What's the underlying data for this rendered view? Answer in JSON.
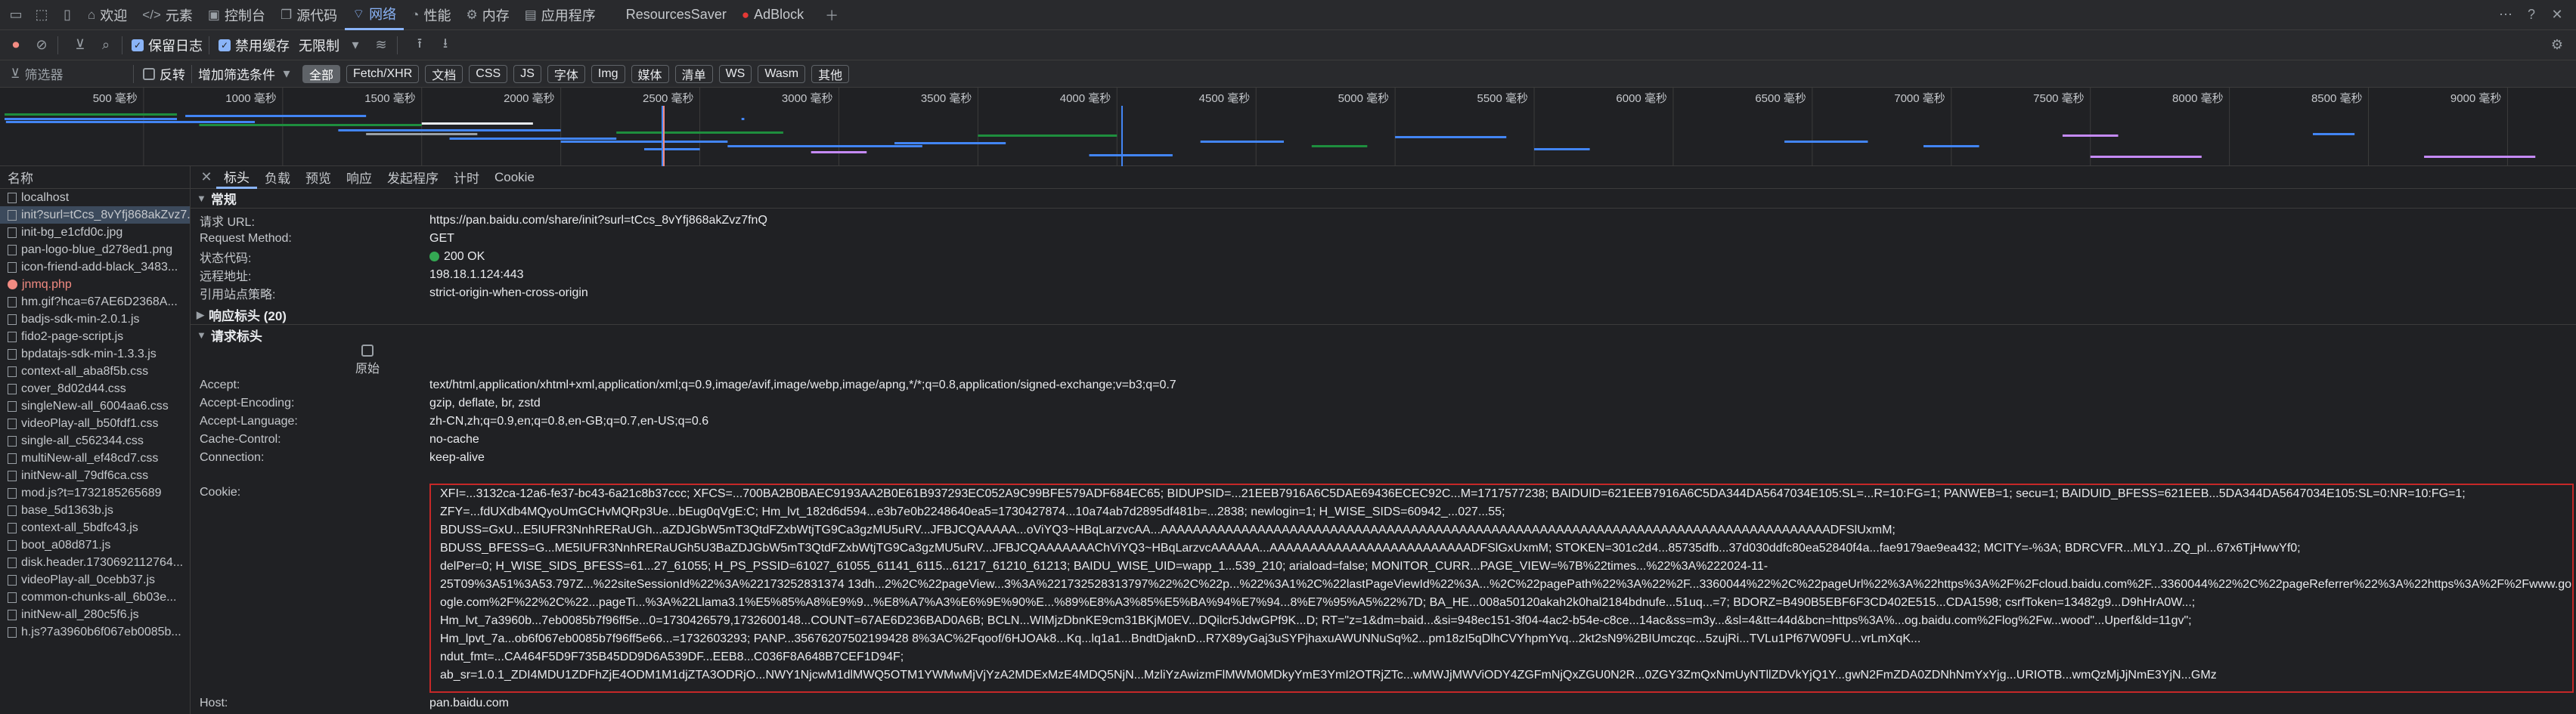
{
  "tabs": [
    {
      "label": "欢迎",
      "icon": "home-icon"
    },
    {
      "label": "元素",
      "icon": "code-icon"
    },
    {
      "label": "控制台",
      "icon": "console-icon"
    },
    {
      "label": "源代码",
      "icon": "source-icon"
    },
    {
      "label": "网络",
      "icon": "wifi-icon",
      "active": true
    },
    {
      "label": "性能",
      "icon": "performance-icon"
    },
    {
      "label": "内存",
      "icon": "memory-icon"
    },
    {
      "label": "应用程序",
      "icon": "application-icon"
    },
    {
      "label": "ResourcesSaver",
      "icon": ""
    },
    {
      "label": "AdBlock",
      "icon": "adblock-icon"
    }
  ],
  "toolbar": {
    "preserve_log": "保留日志",
    "disable_cache": "禁用缓存",
    "throttle": "无限制"
  },
  "filter": {
    "placeholder": "筛选器",
    "invert": "反转",
    "more": "增加筛选条件",
    "chips": [
      "全部",
      "Fetch/XHR",
      "文档",
      "CSS",
      "JS",
      "字体",
      "Img",
      "媒体",
      "清单",
      "WS",
      "Wasm",
      "其他"
    ]
  },
  "timeline": {
    "ticks": [
      "500 毫秒",
      "1000 毫秒",
      "1500 毫秒",
      "2000 毫秒",
      "2500 毫秒",
      "3000 毫秒",
      "3500 毫秒",
      "4000 毫秒",
      "4500 毫秒",
      "5000 毫秒",
      "5500 毫秒",
      "6000 毫秒",
      "6500 毫秒",
      "7000 毫秒",
      "7500 毫秒",
      "8000 毫秒",
      "8500 毫秒",
      "9000 毫秒"
    ]
  },
  "requests": {
    "header": "名称",
    "items": [
      {
        "name": "localhost",
        "red": false
      },
      {
        "name": "init?surl=tCcs_8vYfj868akZvz7...",
        "red": false,
        "selected": true
      },
      {
        "name": "init-bg_e1cfd0c.jpg",
        "red": false
      },
      {
        "name": "pan-logo-blue_d278ed1.png",
        "red": false
      },
      {
        "name": "icon-friend-add-black_3483...",
        "red": false
      },
      {
        "name": "jnmq.php",
        "red": true
      },
      {
        "name": "hm.gif?hca=67AE6D2368A...",
        "red": false
      },
      {
        "name": "badjs-sdk-min-2.0.1.js",
        "red": false
      },
      {
        "name": "fido2-page-script.js",
        "red": false
      },
      {
        "name": "bpdatajs-sdk-min-1.3.3.js",
        "red": false
      },
      {
        "name": "context-all_aba8f5b.css",
        "red": false
      },
      {
        "name": "cover_8d02d44.css",
        "red": false
      },
      {
        "name": "singleNew-all_6004aa6.css",
        "red": false
      },
      {
        "name": "videoPlay-all_b50fdf1.css",
        "red": false
      },
      {
        "name": "single-all_c562344.css",
        "red": false
      },
      {
        "name": "multiNew-all_ef48cd7.css",
        "red": false
      },
      {
        "name": "initNew-all_79df6ca.css",
        "red": false
      },
      {
        "name": "mod.js?t=1732185265689",
        "red": false
      },
      {
        "name": "base_5d1363b.js",
        "red": false
      },
      {
        "name": "context-all_5bdfc43.js",
        "red": false
      },
      {
        "name": "boot_a08d871.js",
        "red": false
      },
      {
        "name": "disk.header.1730692112764...",
        "red": false
      },
      {
        "name": "videoPlay-all_0cebb37.js",
        "red": false
      },
      {
        "name": "common-chunks-all_6b03e...",
        "red": false
      },
      {
        "name": "initNew-all_280c5f6.js",
        "red": false
      },
      {
        "name": "h.js?7a3960b6f067eb0085b...",
        "red": false
      }
    ]
  },
  "detail": {
    "tabs": [
      "标头",
      "负载",
      "预览",
      "响应",
      "发起程序",
      "计时",
      "Cookie"
    ],
    "general": {
      "title": "常规",
      "rows": [
        {
          "k": "请求 URL:",
          "v": "https://pan.baidu.com/share/init?surl=tCcs_8vYfj868akZvz7fnQ"
        },
        {
          "k": "Request Method:",
          "v": "GET"
        },
        {
          "k": "状态代码:",
          "v": "200 OK"
        },
        {
          "k": "远程地址:",
          "v": "198.18.1.124:443"
        },
        {
          "k": "引用站点策略:",
          "v": "strict-origin-when-cross-origin"
        }
      ]
    },
    "response_headers": {
      "title": "响应标头 (20)"
    },
    "request_headers": {
      "title": "请求标头",
      "raw": "原始",
      "rows": [
        {
          "k": "Accept:",
          "v": "text/html,application/xhtml+xml,application/xml;q=0.9,image/avif,image/webp,image/apng,*/*;q=0.8,application/signed-exchange;v=b3;q=0.7"
        },
        {
          "k": "Accept-Encoding:",
          "v": "gzip, deflate, br, zstd"
        },
        {
          "k": "Accept-Language:",
          "v": "zh-CN,zh;q=0.9,en;q=0.8,en-GB;q=0.7,en-US;q=0.6"
        },
        {
          "k": "Cache-Control:",
          "v": "no-cache"
        },
        {
          "k": "Connection:",
          "v": "keep-alive"
        }
      ],
      "cookie_label": "Cookie:",
      "cookie_lines": [
        "XFI=...3132ca-12a6-fe37-bc43-6a21c8b37ccc; XFCS=...700BA2B0BAEC9193AA2B0E61B937293EC052A9C99BFE579ADF684EC65; BIDUPSID=...21EEB7916A6C5DAE69436ECEC92C...M=1717577238; BAIDUID=621EEB7916A6C5DA344DA5647034E105:SL=...R=10:FG=1; PANWEB=1; secu=1; BAIDUID_BFESS=621EEB...5DA344DA5647034E105:SL=0:NR=10:FG=1;",
        "ZFY=...fdUXdb4MQyoUmGCHvMQRp3Ue...bEug0qVgE:C; Hm_lvt_182d6d594...e3b7e0b2248640ea5=1730427874...10a74ab7d2895df481b=...2838; newlogin=1; H_WISE_SIDS=60942_...027...55;",
        "BDUSS=GxU...E5IUFR3NnhRERaUGh...aZDJGbW5mT3QtdFZxbWtjTG9Ca3gzMU5uRV...JFBJCQAAAAA...oViYQ3~HBqLarzvcAA...AAAAAAAAAAAAAAAAAAAAAAAAAAAAAAAAAAAAAAAAAAAAAAAAAAAAAAAAAAAAAAAAAAAAAAAAAAAAAAAAAAADFSlUxmM;",
        "BDUSS_BFESS=G...ME5IUFR3NnhRERaUGh5U3BaZDJGbW5mT3QtdFZxbWtjTG9Ca3gzMU5uRV...JFBJCQAAAAAAAChViYQ3~HBqLarzvcAAAAAA...AAAAAAAAAAAAAAAAAAAAAAAAADFSlGxUxmM; STOKEN=301c2d4...85735dfb...37d030ddfc80ea52840f4a...fae9179ae9ea432; MCITY=-%3A; BDRCVFR...MLYJ...ZQ_pl...67x6TjHwwYf0;",
        "delPer=0; H_WISE_SIDS_BFESS=61...27_61055; H_PS_PSSID=61027_61055_61141_6115...61217_61210_61213; BAIDU_WISE_UID=wapp_1...539_210; ariaload=false; MONITOR_CURR...PAGE_VIEW=%7B%22times...%22%3A%222024-11-",
        "25T09%3A51%3A53.797Z...%22siteSessionId%22%3A%22173252831374 13dh...2%2C%22pageView...3%3A%221732528313797%22%2C%22p...%22%3A1%2C%22lastPageViewId%22%3A...%2C%22pagePath%22%3A%22%2F...3360044%22%2C%22pageUrl%22%3A%22https%3A%2F%2Fcloud.baidu.com%2F...3360044%22%2C%22pageReferrer%22%3A%22https%3A%2F%2Fwww.go",
        "ogle.com%2F%22%2C%22...pageTi...%3A%22Llama3.1%E5%85%A8%E9%9...%E8%A7%A3%E6%9E%90%E...%89%E8%A3%85%E5%BA%94%E7%94...8%E7%95%A5%22%7D; BA_HE...008a50120akah2k0hal2184bdnufe...51uq...=7; BDORZ=B490B5EBF6F3CD402E515...CDA1598; csrfToken=13482g9...D9hHrA0W...;",
        "Hm_lvt_7a3960b...7eb0085b7f96ff5e...0=1730426579,1732600148...COUNT=67AE6D236BAD0A6B; BCLN...WIMjzDbnKE9cm31BKjM0EV...DQilcr5JdwGPf9K...D; RT=\"z=1&dm=baid...&si=948ec151-3f04-4ac2-b54e-c8ce...14ac&ss=m3y...&sl=4&tt=44d&bcn=https%3A%...og.baidu.com%2Flog%2Fw...wood\"...Uperf&ld=11gv\";",
        "Hm_lpvt_7a...ob6f067eb0085b7f96ff5e66...=1732603293; PANP...35676207502199428 8%3AC%2Fqoof/6HJOAk8...Kq...lq1a1...BndtDjaknD...R7X89yGaj3uSYPjhaxuAWUNNuSq%2...pm18zI5qDlhCVYhpmYvq...2kt2sN9%2BIUmczqc...5zujRi...TVLu1Pf67W09FU...vrLmXqK...",
        "ndut_fmt=...CA464F5D9F735B45DD9D6A539DF...EEB8...C036F8A648B7CEF1D94F;",
        "ab_sr=1.0.1_ZDI4MDU1ZDFhZjE4ODM1M1djZTA3ODRjO...NWY1NjcwM1dlMWQ5OTM1YWMwMjVjYzA2MDExMzE4MDQ5NjN...MzliYzAwizmFlMWM0MDkyYmE3YmI2OTRjZTc...wMWJjMWViODY4ZGFmNjQxZGU0N2R...0ZGY3ZmQxNmUyNTllZDVkYjQ1Y...gwN2FmZDA0ZDNhNmYxYjg...URIOTB...wmQzMjJjNmE3YjN...GMz"
      ],
      "host_label": "Host:",
      "host_value": "pan.baidu.com"
    }
  },
  "colors": {
    "accent": "#8ab4f8",
    "status_ok": "#34a853",
    "highlight_border": "#c62828"
  }
}
